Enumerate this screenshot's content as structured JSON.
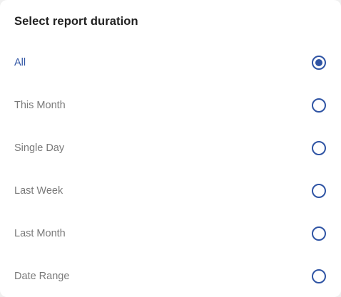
{
  "dialog": {
    "title": "Select report duration",
    "options": [
      {
        "label": "All",
        "selected": true
      },
      {
        "label": "This Month",
        "selected": false
      },
      {
        "label": "Single Day",
        "selected": false
      },
      {
        "label": "Last Week",
        "selected": false
      },
      {
        "label": "Last Month",
        "selected": false
      },
      {
        "label": "Date Range",
        "selected": false
      }
    ]
  },
  "colors": {
    "accent": "#2f54a4",
    "text_primary": "#212121",
    "text_secondary": "#7a7a7a",
    "background": "#ffffff"
  }
}
